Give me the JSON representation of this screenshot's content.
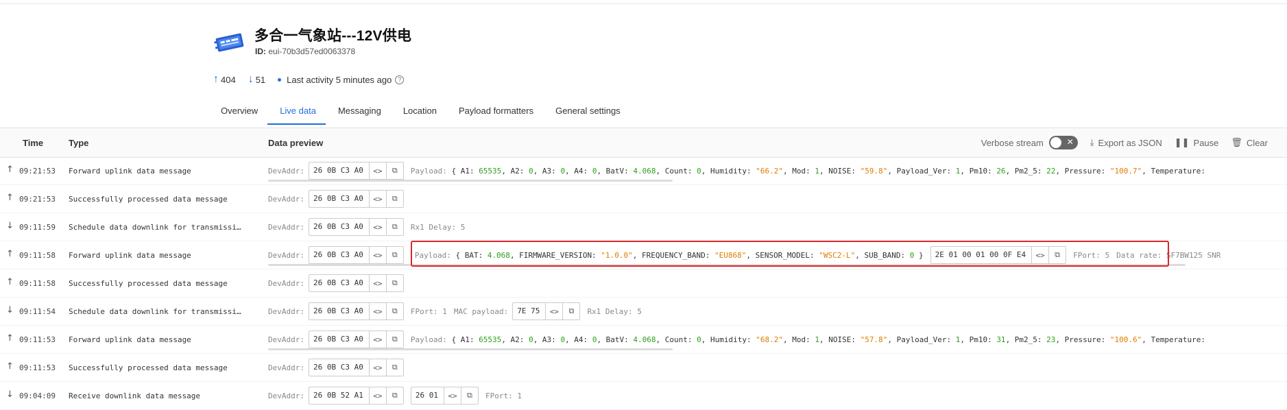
{
  "device": {
    "title": "多合一气象站---12V供电",
    "id_label": "ID:",
    "id_value": "eui-70b3d57ed0063378",
    "uplink_count": "404",
    "downlink_count": "51",
    "last_activity": "Last activity 5 minutes ago"
  },
  "tabs": [
    {
      "label": "Overview"
    },
    {
      "label": "Live data"
    },
    {
      "label": "Messaging"
    },
    {
      "label": "Location"
    },
    {
      "label": "Payload formatters"
    },
    {
      "label": "General settings"
    }
  ],
  "table": {
    "col_time": "Time",
    "col_type": "Type",
    "col_preview": "Data preview",
    "verbose_label": "Verbose stream",
    "export_label": "Export as JSON",
    "pause_label": "Pause",
    "clear_label": "Clear"
  },
  "rows": [
    {
      "dir": "↑",
      "time": "09:21:53",
      "type": "Forward uplink data message",
      "devaddr": "26 0B C3 A0",
      "payload_text": "Payload: { A1: 65535, A2: 0, A3: 0, A4: 0, BatV: 4.068, Count: 0, Humidity: \"66.2\", Mod: 1, NOISE: \"59.8\", Payload_Ver: 1, Pm10: 26, Pm2_5: 22, Pressure: \"100.7\", Temperature:"
    },
    {
      "dir": "↑",
      "time": "09:21:53",
      "type": "Successfully processed data message",
      "devaddr": "26 0B C3 A0"
    },
    {
      "dir": "↓",
      "time": "09:11:59",
      "type": "Schedule data downlink for transmissi…",
      "devaddr": "26 0B C3 A0",
      "extra": "Rx1 Delay: 5"
    },
    {
      "dir": "↑",
      "time": "09:11:58",
      "type": "Forward uplink data message",
      "devaddr": "26 0B C3 A0",
      "payload_text": "Payload: { BAT: 4.068, FIRMWARE_VERSION: \"1.0.0\", FREQUENCY_BAND: \"EU868\", SENSOR_MODEL: \"WSC2-L\", SUB_BAND: 0 }",
      "frm_payload": "2E 01 00 01 00 0F E4",
      "fport": "FPort: 5",
      "data_rate": "Data rate: SF7BW125  SNR"
    },
    {
      "dir": "↑",
      "time": "09:11:58",
      "type": "Successfully processed data message",
      "devaddr": "26 0B C3 A0"
    },
    {
      "dir": "↓",
      "time": "09:11:54",
      "type": "Schedule data downlink for transmissi…",
      "devaddr": "26 0B C3 A0",
      "fport": "FPort: 1",
      "mac_label": "MAC payload:",
      "mac_payload": "7E 75",
      "extra": "Rx1 Delay: 5"
    },
    {
      "dir": "↑",
      "time": "09:11:53",
      "type": "Forward uplink data message",
      "devaddr": "26 0B C3 A0",
      "payload_text": "Payload: { A1: 65535, A2: 0, A3: 0, A4: 0, BatV: 4.068, Count: 0, Humidity: \"68.2\", Mod: 1, NOISE: \"57.8\", Payload_Ver: 1, Pm10: 31, Pm2_5: 23, Pressure: \"100.6\", Temperature:"
    },
    {
      "dir": "↑",
      "time": "09:11:53",
      "type": "Successfully processed data message",
      "devaddr": "26 0B C3 A0"
    },
    {
      "dir": "↓",
      "time": "09:04:09",
      "type": "Receive downlink data message",
      "devaddr": "26 0B 52 A1",
      "frm_payload": "26 01",
      "fport": "FPort: 1"
    }
  ],
  "labels": {
    "devaddr": "DevAddr:"
  },
  "colors": {
    "accent": "#1f6fd9",
    "highlight": "#d9262a",
    "number": "#2f9e1c",
    "string": "#e07b00"
  }
}
